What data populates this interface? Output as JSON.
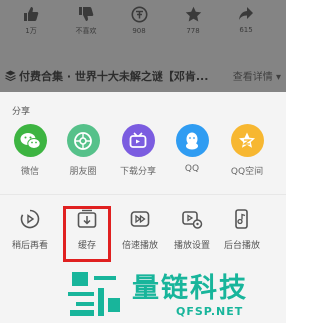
{
  "video": {
    "stats": [
      {
        "icon": "thumbs-up-icon",
        "value": "1万"
      },
      {
        "icon": "thumbs-down-icon",
        "value": "不喜欢"
      },
      {
        "icon": "coin-icon",
        "value": "908"
      },
      {
        "icon": "star-icon",
        "value": "778"
      },
      {
        "icon": "share-arrow-icon",
        "value": "615"
      }
    ],
    "collection": {
      "title": "付费合集 · 世界十大未解之谜【邓肯...",
      "more": "查看详情 ▾"
    }
  },
  "share_sheet": {
    "title": "分享",
    "targets": [
      {
        "label": "微信",
        "icon": "wechat-icon",
        "color": "#3db441"
      },
      {
        "label": "朋友圈",
        "icon": "moments-icon",
        "color": "#56c18a"
      },
      {
        "label": "下载分享",
        "icon": "download-share-icon",
        "color": "#7b5ce0"
      },
      {
        "label": "QQ",
        "icon": "qq-icon",
        "color": "#2f9cf2"
      },
      {
        "label": "QQ空间",
        "icon": "qzone-icon",
        "color": "#f7b731"
      }
    ],
    "tools": [
      {
        "label": "稍后再看",
        "icon": "watch-later-icon"
      },
      {
        "label": "缓存",
        "icon": "cache-icon"
      },
      {
        "label": "倍速播放",
        "icon": "speed-play-icon"
      },
      {
        "label": "播放设置",
        "icon": "play-settings-icon"
      },
      {
        "label": "后台播放",
        "icon": "background-play-icon"
      }
    ],
    "highlight_color": "#e02020"
  },
  "watermark": {
    "cn": "量链科技",
    "en": "QFSP.NET",
    "color": "#18b59b"
  }
}
